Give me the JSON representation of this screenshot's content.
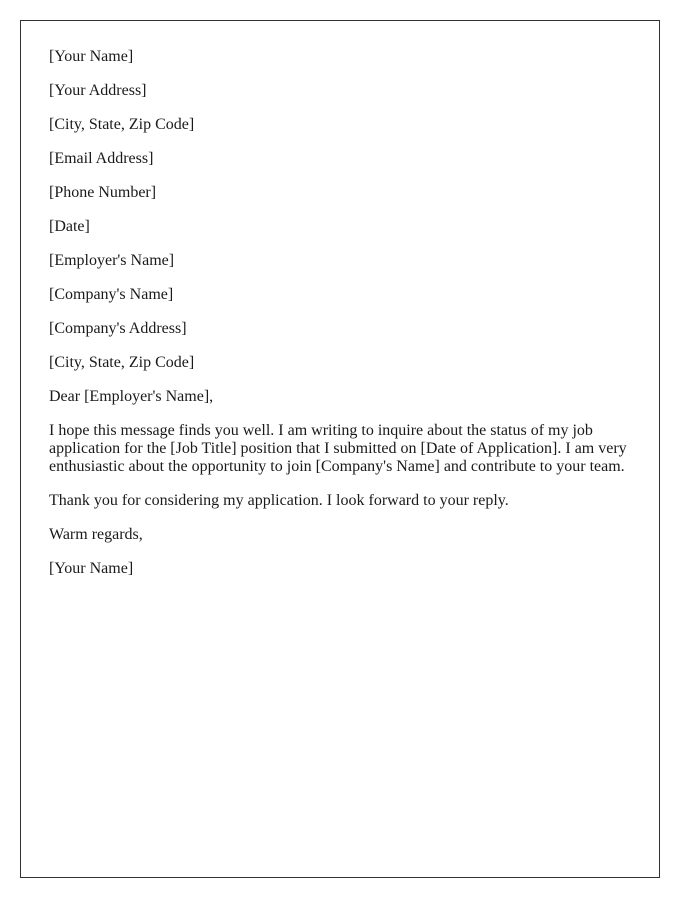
{
  "sender": {
    "name": "[Your Name]",
    "address": "[Your Address]",
    "city_state_zip": "[City, State, Zip Code]",
    "email": "[Email Address]",
    "phone": "[Phone Number]",
    "date": "[Date]"
  },
  "recipient": {
    "employer_name": "[Employer's Name]",
    "company_name": "[Company's Name]",
    "company_address": "[Company's Address]",
    "city_state_zip": "[City, State, Zip Code]"
  },
  "salutation": "Dear [Employer's Name],",
  "body": [
    "I hope this message finds you well. I am writing to inquire about the status of my job application for the [Job Title] position that I submitted on [Date of Application]. I am very enthusiastic about the opportunity to join [Company's Name] and contribute to your team.",
    "Thank you for considering my application. I look forward to your reply."
  ],
  "closing": "Warm regards,",
  "signature": "[Your Name]"
}
